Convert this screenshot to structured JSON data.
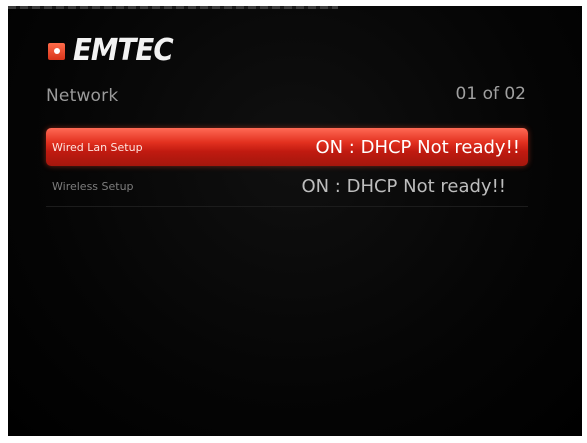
{
  "brand": {
    "name": "EMTEC"
  },
  "header": {
    "title": "Network",
    "page_counter": "01 of 02"
  },
  "menu": {
    "items": [
      {
        "label": "Wired Lan Setup",
        "value": "ON : DHCP Not ready!!",
        "selected": true
      },
      {
        "label": "Wireless Setup",
        "value": "ON : DHCP Not ready!!",
        "selected": false
      }
    ]
  },
  "colors": {
    "background": "#000000",
    "highlight": "#d8281a",
    "text_primary": "#ffffff",
    "text_secondary": "#9a9a9a"
  },
  "icons": {
    "brand_mark": "emtec-logo-icon"
  }
}
